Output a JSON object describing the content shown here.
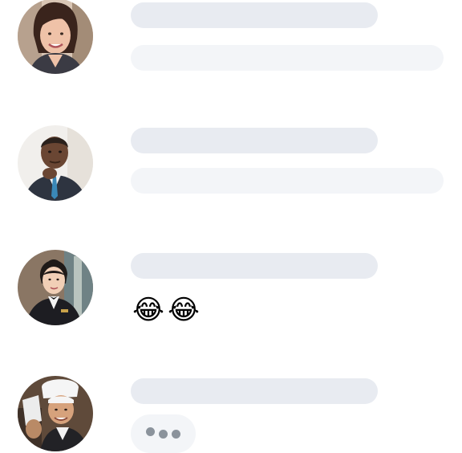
{
  "conversation": {
    "rows": [
      {
        "avatar_icon": "woman-avatar",
        "message_type": "text-placeholder"
      },
      {
        "avatar_icon": "man-in-suit-avatar",
        "message_type": "text-placeholder"
      },
      {
        "avatar_icon": "hotel-staff-woman-avatar",
        "message_type": "emoji",
        "emojis": [
          "😂",
          "😂"
        ]
      },
      {
        "avatar_icon": "chef-avatar",
        "message_type": "typing-indicator"
      }
    ]
  },
  "colors": {
    "name_placeholder": "#e8ebf1",
    "message_placeholder": "#f3f5f8",
    "typing_dot": "#8b939c"
  }
}
